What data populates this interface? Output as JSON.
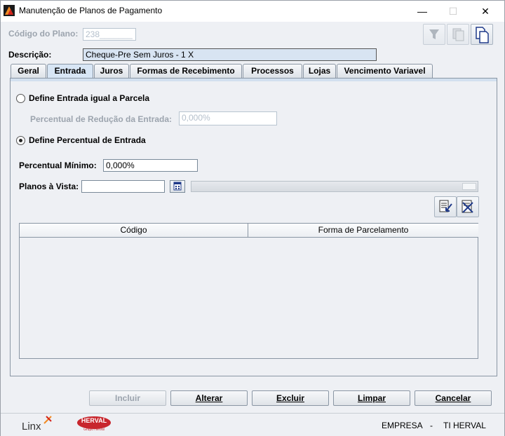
{
  "window": {
    "title": "Manutenção de Planos de Pagamento",
    "minimize": "—",
    "maximize": "☐",
    "close": "✕"
  },
  "header": {
    "codigo_label": "Código do Plano:",
    "codigo_value": "238_______",
    "descricao_label": "Descrição:",
    "descricao_value": "Cheque-Pre Sem Juros - 1 X"
  },
  "tabs": [
    {
      "label": "Geral",
      "active": false
    },
    {
      "label": "Entrada",
      "active": true
    },
    {
      "label": "Juros",
      "active": false
    },
    {
      "label": "Formas de Recebimento",
      "active": false
    },
    {
      "label": "Processos",
      "active": false
    },
    {
      "label": "Lojas",
      "active": false
    },
    {
      "label": "Vencimento Variavel",
      "active": false
    }
  ],
  "entrada": {
    "option1_label": "Define Entrada igual a Parcela",
    "reducao_label": "Percentual de Redução da Entrada:",
    "reducao_value": "0,000%",
    "option2_label": "Define Percentual de Entrada",
    "selected_option": 2,
    "minimo_label": "Percentual Mínimo:",
    "minimo_value": "0,000%",
    "vista_label": "Planos à Vista:",
    "vista_value": ""
  },
  "table": {
    "columns": [
      "Código",
      "Forma de Parcelamento"
    ],
    "rows": []
  },
  "actions": {
    "incluir": "Incluir",
    "alterar": "Alterar",
    "excluir": "Excluir",
    "limpar": "Limpar",
    "cancelar": "Cancelar"
  },
  "footer": {
    "logo_linx": "Linx",
    "logo_herval": "HERVAL",
    "logo_herval_sub": "Grupo Herval",
    "empresa_label": "EMPRESA",
    "separator": "-",
    "empresa_value": "TI HERVAL"
  },
  "colors": {
    "accent": "#d8e6f5",
    "herval_red": "#c8262d",
    "linx_orange": "#f08a24"
  }
}
